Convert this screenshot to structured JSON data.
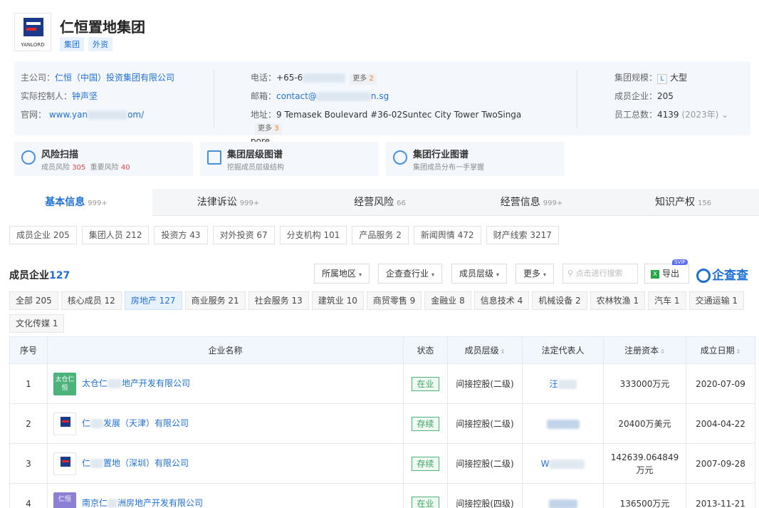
{
  "company": {
    "logo_caption": "YANLORD",
    "title": "仁恒置地集团",
    "tags": [
      "集团",
      "外资"
    ]
  },
  "info": {
    "parent_label": "主公司：",
    "parent_value": "仁恒（中国）投资集团有限公司",
    "controller_label": "实际控制人：",
    "controller_value": "钟声坚",
    "website_label": "官网：",
    "website_prefix": "www.yan",
    "website_suffix": "om/",
    "phone_label": "电话：",
    "phone_value": "+65-6",
    "phone_more": "更多",
    "phone_more_count": "2",
    "email_label": "邮箱：",
    "email_prefix": "contact@",
    "email_suffix": "n.sg",
    "address_label": "地址：",
    "address_line1": "9 Temasek Boulevard #36-02Suntec City Tower TwoSinga",
    "address_line2": "pore",
    "address_more": "更多",
    "address_more_count": "3",
    "scale_label": "集团规模：",
    "scale_badge": "L",
    "scale_value": "大型",
    "members_label": "成员企业：",
    "members_value": "205",
    "employees_label": "员工总数：",
    "employees_value": "4139",
    "employees_year": "(2023年)"
  },
  "cards": [
    {
      "title": "风险扫描",
      "sub_a": "成员风险",
      "sub_a_num": "305",
      "sub_b": "重要风险",
      "sub_b_num": "40"
    },
    {
      "title": "集团层级图谱",
      "sub": "挖掘成员层级结构"
    },
    {
      "title": "集团行业图谱",
      "sub": "集团成员分布一手掌握"
    }
  ],
  "main_tabs": [
    {
      "label": "基本信息",
      "count": "999+"
    },
    {
      "label": "法律诉讼",
      "count": "999+"
    },
    {
      "label": "经营风险",
      "count": "66"
    },
    {
      "label": "经营信息",
      "count": "999+"
    },
    {
      "label": "知识产权",
      "count": "156"
    }
  ],
  "sub_tabs": [
    "成员企业 205",
    "集团人员 212",
    "投资方 43",
    "对外投资 67",
    "分支机构 101",
    "产品服务 2",
    "新闻舆情 472",
    "财产线索 3217"
  ],
  "section": {
    "title": "成员企业",
    "count": "127",
    "filters": [
      "所属地区",
      "企查查行业",
      "成员层级",
      "更多"
    ],
    "search_placeholder": "点击进行搜索",
    "export": "导出",
    "svip": "SVIP",
    "brand": "企查查"
  },
  "industries": [
    "全部 205",
    "核心成员 12",
    "房地产 127",
    "商业服务 21",
    "社会服务 13",
    "建筑业 10",
    "商贸零售 9",
    "金融业 8",
    "信息技术 4",
    "机械设备 2",
    "农林牧渔 1",
    "汽车 1",
    "交通运输 1",
    "文化传媒 1"
  ],
  "table": {
    "headers": [
      "序号",
      "企业名称",
      "状态",
      "成员层级",
      "法定代表人",
      "注册资本",
      "成立日期"
    ],
    "rows": [
      {
        "no": "1",
        "logo_text": "太仓仁恒",
        "name_a": "太仓仁",
        "name_b": "地产开发有限公司",
        "status": "在业",
        "level": "间接控股(二级)",
        "rep": "汪",
        "capital": "333000万元",
        "date": "2020-07-09"
      },
      {
        "no": "2",
        "logo_text": "",
        "name_a": "仁",
        "name_b": "发展（天津）有限公司",
        "status": "存续",
        "level": "间接控股(二级)",
        "rep": "",
        "capital": "20400万美元",
        "date": "2004-04-22"
      },
      {
        "no": "3",
        "logo_text": "",
        "name_a": "仁",
        "name_b": "置地（深圳）有限公司",
        "status": "存续",
        "level": "间接控股(二级)",
        "rep": "W",
        "capital": "142639.064849万元",
        "date": "2007-09-28"
      },
      {
        "no": "4",
        "logo_text": "仁恒",
        "name_a": "南京仁",
        "name_b": "洲房地产开发有限公司",
        "status": "在业",
        "level": "间接控股(四级)",
        "rep": "",
        "capital": "136500万元",
        "date": "2013-11-21"
      }
    ]
  },
  "colors": {
    "accent": "#1f6fd6",
    "risk": "#e64545",
    "status_green": "#3aa35f"
  }
}
